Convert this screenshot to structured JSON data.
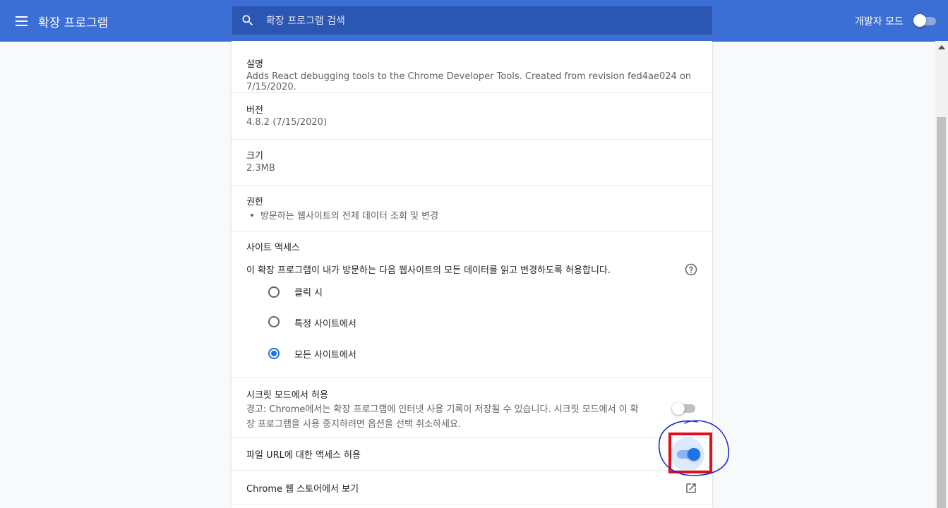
{
  "header": {
    "title": "확장 프로그램",
    "search_placeholder": "확장 프로그램 검색",
    "devmode_label": "개발자 모드",
    "devmode_on": false,
    "bar_color": "#3c6fd5"
  },
  "details": {
    "description": {
      "title": "설명",
      "text": "Adds React debugging tools to the Chrome Developer Tools. Created from revision fed4ae024 on 7/15/2020."
    },
    "version": {
      "title": "버전",
      "text": "4.8.2 (7/15/2020)"
    },
    "size": {
      "title": "크기",
      "text": "2.3MB"
    },
    "permissions": {
      "title": "권한",
      "items": [
        "방문하는 웹사이트의 전체 데이터 조회 및 변경"
      ]
    },
    "site_access": {
      "title": "사이트 액세스",
      "description": "이 확장 프로그램이 내가 방문하는 다음 웹사이트의 모든 데이터를 읽고 변경하도록 허용합니다.",
      "options": [
        "클릭 시",
        "특정 사이트에서",
        "모든 사이트에서"
      ],
      "selected": "모든 사이트에서"
    },
    "incognito": {
      "title": "시크릿 모드에서 허용",
      "warning_line1": "경고: Chrome에서는 확장 프로그램에 인터넷 사용 기록이 저장될 수 있습니다. 시크릿 모드에서 이 확",
      "warning_line2": "장 프로그램을 사용 중지하려면 옵션을 선택 취소하세요.",
      "enabled": false
    },
    "file_urls": {
      "title": "파일 URL에 대한 액세스 허용",
      "enabled": true
    },
    "webstore": {
      "title": "Chrome 웹 스토어에서 보기"
    }
  },
  "icons": {
    "menu": "hamburger-menu-icon",
    "search": "search-icon",
    "help": "help-circle-icon",
    "external": "open-in-new-icon"
  },
  "annotation_colors": {
    "box": "#e0101a",
    "circle": "#1a2fcc"
  }
}
